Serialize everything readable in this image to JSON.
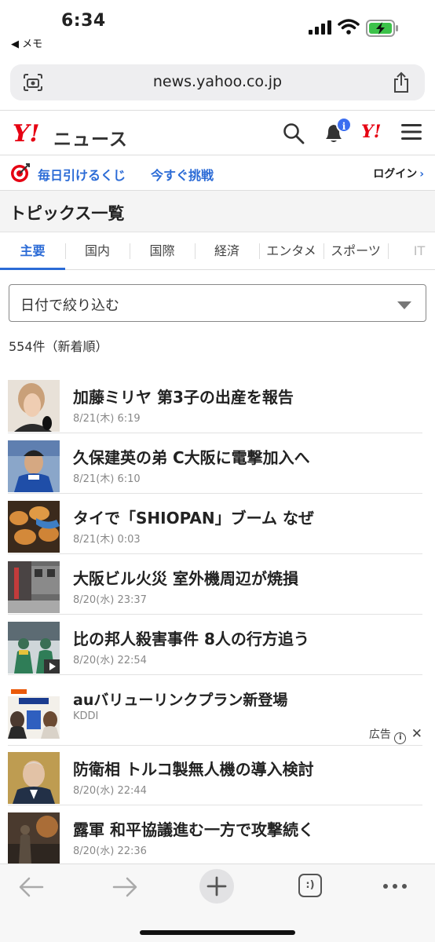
{
  "status": {
    "time": "6:34",
    "back_app": "◀ メモ"
  },
  "browser": {
    "url": "news.yahoo.co.jp"
  },
  "header": {
    "logo": "Y!",
    "logo_sub": "ニュース",
    "notification_count": "i",
    "yahoo_mark": "Y!"
  },
  "promo": {
    "text": "毎日引けるくじ",
    "cta": "今すぐ挑戦",
    "login": "ログイン"
  },
  "topics": {
    "title": "トピックス一覧"
  },
  "tabs": [
    {
      "label": "主要"
    },
    {
      "label": "国内"
    },
    {
      "label": "国際"
    },
    {
      "label": "経済"
    },
    {
      "label": "エンタメ"
    },
    {
      "label": "スポーツ"
    },
    {
      "label": "IT"
    }
  ],
  "filter": {
    "label": "日付で絞り込む"
  },
  "count": "554件（新着順）",
  "articles": [
    {
      "title": "加藤ミリヤ 第3子の出産を報告",
      "meta": "8/21(木) 6:19"
    },
    {
      "title": "久保建英の弟 C大阪に電撃加入へ",
      "meta": "8/21(木) 6:10"
    },
    {
      "title": "タイで「SHIOPAN」ブーム なぜ",
      "meta": "8/21(木) 0:03"
    },
    {
      "title": "大阪ビル火災 室外機周辺が焼損",
      "meta": "8/20(水) 23:37"
    },
    {
      "title": "比の邦人殺害事件 8人の行方追う",
      "meta": "8/20(水) 22:54"
    },
    {
      "title": "auバリューリンクプラン新登場",
      "meta": "KDDI",
      "ad_label": "広告"
    },
    {
      "title": "防衛相 トルコ製無人機の導入検討",
      "meta": "8/20(水) 22:44"
    },
    {
      "title": "露軍 和平協議進む一方で攻撃続く",
      "meta": "8/20(水) 22:36"
    }
  ],
  "toolbar": {
    "tabs_label": ":)"
  },
  "colors": {
    "brand_red": "#e60012",
    "link_blue": "#2b6bd6"
  }
}
